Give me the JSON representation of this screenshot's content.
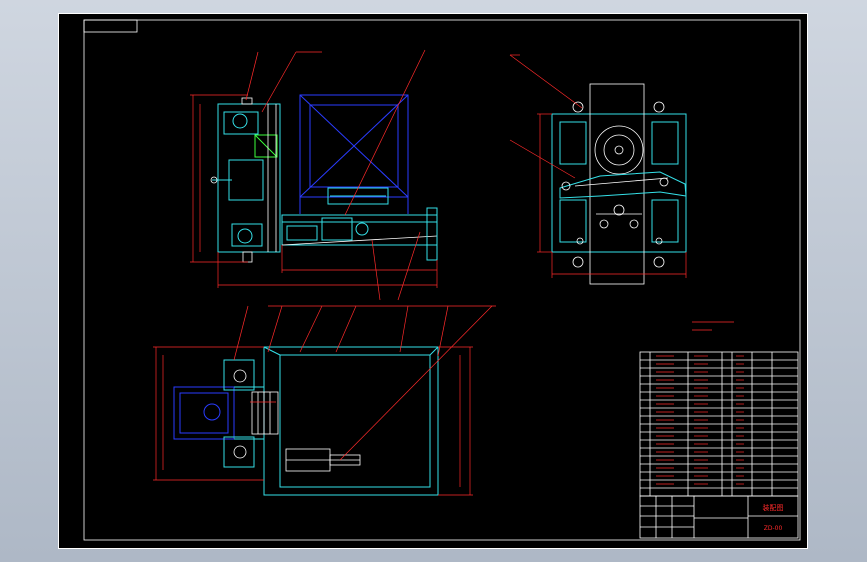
{
  "drawing": {
    "title_block_label": "装配图",
    "drawing_number": "ZD-00"
  },
  "colors": {
    "background": "#000000",
    "frame": "#ffffff",
    "dimension": "#ff2a2a",
    "outline": "#35e0e8",
    "hidden": "#2a3cff",
    "accent": "#3cff3c"
  }
}
